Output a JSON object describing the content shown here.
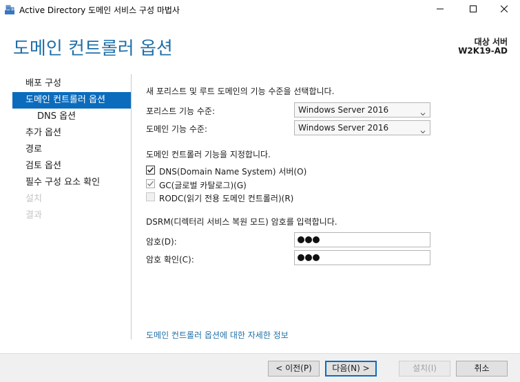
{
  "window": {
    "title": "Active Directory 도메인 서비스 구성 마법사",
    "minimize_icon": "minimize-icon",
    "maximize_icon": "maximize-icon",
    "close_icon": "close-icon"
  },
  "header": {
    "title": "도메인 컨트롤러 옵션",
    "target_label": "대상 서버",
    "target_name": "W2K19-AD"
  },
  "nav": {
    "items": [
      {
        "label": "배포 구성",
        "state": "normal"
      },
      {
        "label": "도메인 컨트롤러 옵션",
        "state": "selected"
      },
      {
        "label": "DNS 옵션",
        "state": "sub"
      },
      {
        "label": "추가 옵션",
        "state": "normal"
      },
      {
        "label": "경로",
        "state": "normal"
      },
      {
        "label": "검토 옵션",
        "state": "normal"
      },
      {
        "label": "필수 구성 요소 확인",
        "state": "normal"
      },
      {
        "label": "설치",
        "state": "disabled"
      },
      {
        "label": "결과",
        "state": "disabled"
      }
    ]
  },
  "main": {
    "functional_level_heading": "새 포리스트 및 루트 도메인의 기능 수준을 선택합니다.",
    "forest_level_label": "포리스트 기능 수준:",
    "forest_level_value": "Windows Server 2016",
    "domain_level_label": "도메인 기능 수준:",
    "domain_level_value": "Windows Server 2016",
    "capabilities_heading": "도메인 컨트롤러 기능을 지정합니다.",
    "dns_label": "DNS(Domain Name System) 서버(O)",
    "gc_label": "GC(글로벌 카탈로그)(G)",
    "rodc_label": "RODC(읽기 전용 도메인 컨트롤러)(R)",
    "dsrm_heading": "DSRM(디렉터리 서비스 복원 모드) 암호를 입력합니다.",
    "password_label": "암호(D):",
    "confirm_label": "암호 확인(C):",
    "more_info_link": "도메인 컨트롤러 옵션에 대한 자세한 정보"
  },
  "footer": {
    "prev_label": "< 이전(P)",
    "next_label": "다음(N) >",
    "install_label": "설치(I)",
    "cancel_label": "취소"
  },
  "colors": {
    "accent": "#0b6cbd",
    "title_blue": "#1f6fa8"
  }
}
